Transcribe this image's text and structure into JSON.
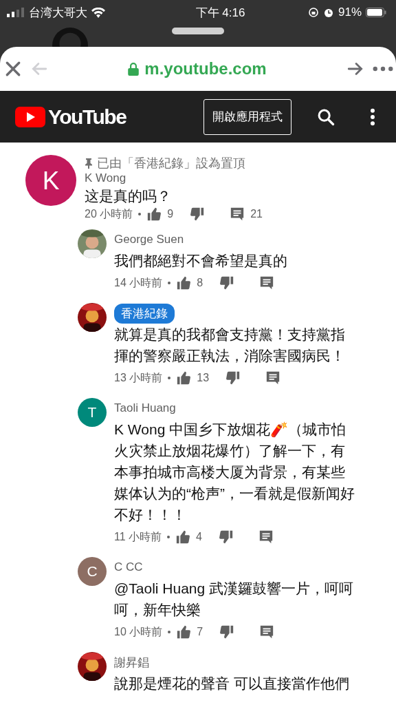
{
  "status_bar": {
    "carrier": "台湾大哥大",
    "time": "下午 4:16",
    "battery": "91%"
  },
  "browser": {
    "url": "m.youtube.com"
  },
  "header": {
    "logo": "YouTube",
    "open_app": "開啟應用程式"
  },
  "comments": [
    {
      "reply": false,
      "pinned": "已由「香港紀錄」設為置頂",
      "avatar": {
        "kind": "letter",
        "letter": "K",
        "color": "#c2185b"
      },
      "author": "K Wong",
      "owner": false,
      "text": "这是真的吗？",
      "time": "20 小時前",
      "likes": "9",
      "replies": "21"
    },
    {
      "reply": true,
      "author": "George Suen",
      "owner": false,
      "text": "我們都絕對不會希望是真的",
      "time": "14 小時前",
      "likes": "8"
    },
    {
      "reply": true,
      "author": "香港紀錄",
      "owner": true,
      "text": "就算是真的我都會支持黨！支持黨指揮的警察嚴正執法，消除害國病民！",
      "time": "13 小時前",
      "likes": "13"
    },
    {
      "reply": true,
      "avatar": {
        "kind": "letter",
        "letter": "T",
        "color": "#00897b"
      },
      "author": "Taoli Huang",
      "owner": false,
      "text": "K Wong 中国乡下放烟花🧨（城市怕火灾禁止放烟花爆竹）了解一下，有本事拍城市高楼大厦为背景，有某些媒体认为的“枪声”，一看就是假新闻好不好！！！",
      "time": "11 小時前",
      "likes": "4"
    },
    {
      "reply": true,
      "avatar": {
        "kind": "letter",
        "letter": "C",
        "color": "#8d6e63"
      },
      "author": "C CC",
      "owner": false,
      "text": "@Taoli Huang 武漢鑼鼓響一片，呵呵呵，新年快樂",
      "time": "10 小時前",
      "likes": "7"
    },
    {
      "reply": true,
      "author": "謝昇錩",
      "owner": false,
      "text": "說那是煙花的聲音 可以直接當作他們"
    }
  ]
}
